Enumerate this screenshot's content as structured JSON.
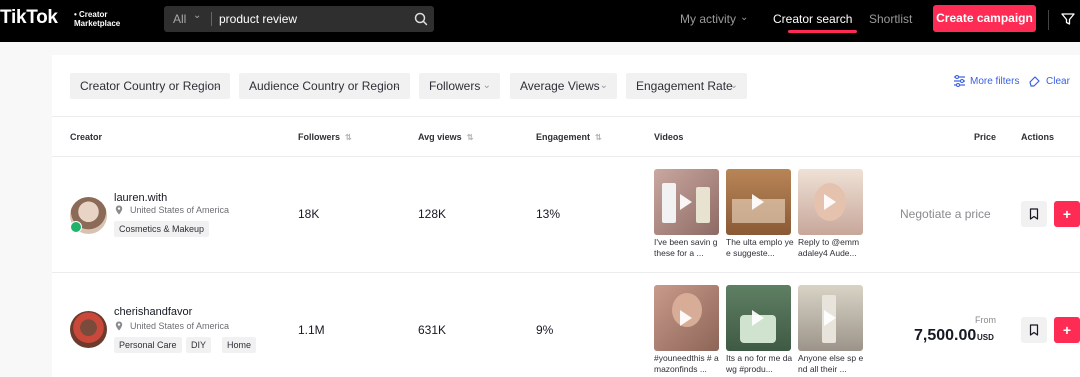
{
  "brand": {
    "logo": "TikTok",
    "sub_line1": "• Creator",
    "sub_line2": "Marketplace"
  },
  "search": {
    "scope": "All",
    "query": "product review",
    "placeholder": ""
  },
  "nav": {
    "my_activity": "My activity",
    "creator_search": "Creator search",
    "shortlist": "Shortlist",
    "create_campaign": "Create campaign"
  },
  "filters": {
    "chips": [
      "Creator Country or Region",
      "Audience Country or Region",
      "Followers",
      "Average Views",
      "Engagement Rate"
    ],
    "more_filters": "More filters",
    "clear": "Clear"
  },
  "table": {
    "headers": {
      "creator": "Creator",
      "followers": "Followers",
      "avg_views": "Avg views",
      "engagement": "Engagement",
      "videos": "Videos",
      "price": "Price",
      "actions": "Actions"
    },
    "rows": [
      {
        "name": "lauren.with",
        "location": "United States of America",
        "tags": [
          "Cosmetics & Makeup"
        ],
        "followers": "18K",
        "avg_views": "128K",
        "engagement": "13%",
        "videos": [
          {
            "caption": "I've been savin g these for a ..."
          },
          {
            "caption": "The ulta emplo yee suggeste..."
          },
          {
            "caption": "Reply to @emm adaley4 Aude..."
          }
        ],
        "price": "Negotiate a price"
      },
      {
        "name": "cherishandfavor",
        "location": "United States of America",
        "tags": [
          "Personal Care",
          "DIY",
          "Home"
        ],
        "followers": "1.1M",
        "avg_views": "631K",
        "engagement": "9%",
        "videos": [
          {
            "caption": "#youneedthis # amazonfinds ..."
          },
          {
            "caption": "Its a no for me dawg #produ..."
          },
          {
            "caption": "Anyone else sp end all their ..."
          }
        ],
        "price_from": "From",
        "price": "7,500.00",
        "currency": "USD"
      }
    ]
  },
  "colors": {
    "accent": "#fe2c55",
    "link": "#3a5fe0",
    "verified": "#20b26b"
  },
  "icons": {
    "search": "search-icon",
    "filter": "filter-icon",
    "pin": "location-pin-icon",
    "bookmark": "bookmark-icon",
    "add": "plus-icon",
    "play": "play-icon",
    "sliders": "sliders-icon",
    "eraser": "eraser-icon",
    "chevron": "chevron-down-icon"
  }
}
